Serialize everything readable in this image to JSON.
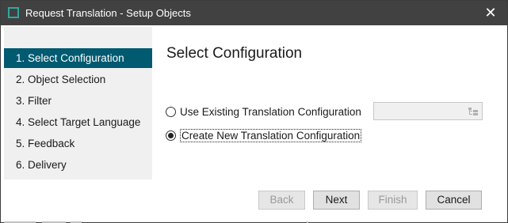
{
  "window": {
    "title": "Request Translation - Setup Objects",
    "close_glyph": "✕",
    "accent_color": "#2ea8a0"
  },
  "sidebar": {
    "items": [
      {
        "label": "1. Select Configuration",
        "active": true
      },
      {
        "label": "2. Object Selection",
        "active": false
      },
      {
        "label": "3. Filter",
        "active": false
      },
      {
        "label": "4. Select Target Language",
        "active": false
      },
      {
        "label": "5. Feedback",
        "active": false
      },
      {
        "label": "6. Delivery",
        "active": false
      }
    ],
    "active_color": "#005a70"
  },
  "main": {
    "title": "Select Configuration",
    "options": [
      {
        "label": "Use Existing Translation Configuration",
        "checked": false
      },
      {
        "label": "Create New Translation Configuration",
        "checked": true
      }
    ],
    "config_select": {
      "value": "",
      "icon": "tree-browse-icon",
      "enabled": false
    }
  },
  "footer": {
    "back_label": "Back",
    "next_label": "Next",
    "finish_label": "Finish",
    "cancel_label": "Cancel"
  }
}
